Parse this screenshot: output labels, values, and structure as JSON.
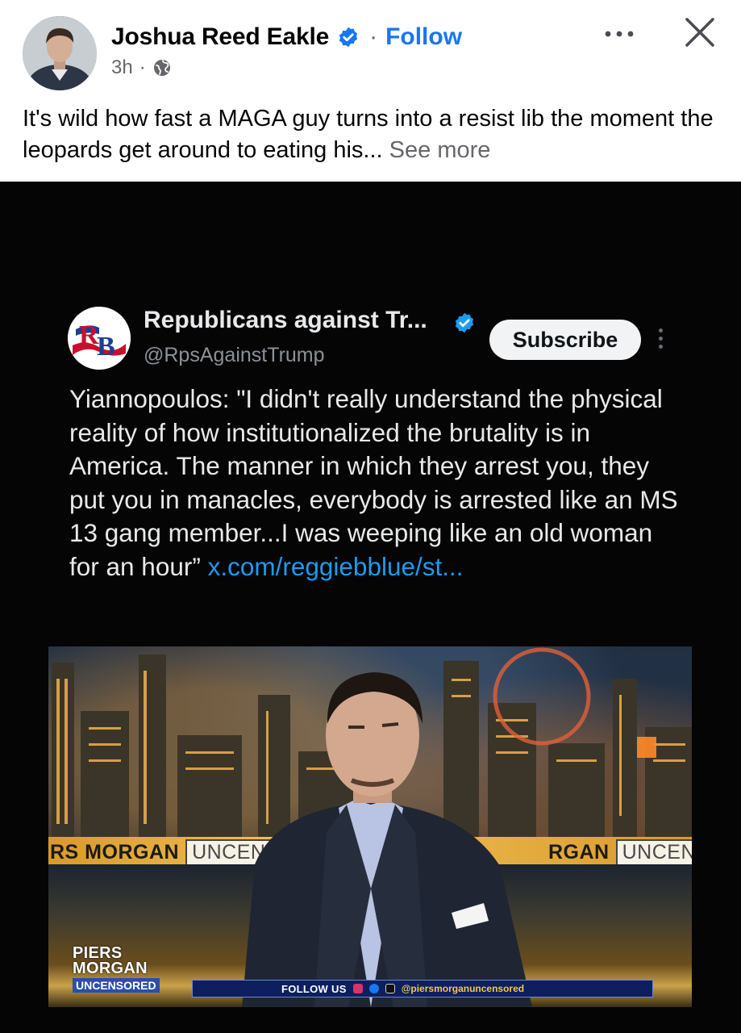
{
  "post": {
    "author": "Joshua Reed Eakle",
    "separator": "·",
    "follow_label": "Follow",
    "time": "3h",
    "meta_separator": "·",
    "text": "It's wild how fast a MAGA guy turns into a resist lib the moment the leopards get around to eating his...",
    "see_more": "See more"
  },
  "icons": {
    "verified": "verified-badge-icon",
    "globe": "globe-icon",
    "more": "more-options-icon",
    "close": "close-icon"
  },
  "tweet": {
    "name": "Republicans against Tr...",
    "handle": "@RpsAgainstTrump",
    "subscribe_label": "Subscribe",
    "avatar_text": "RB",
    "body": "Yiannopoulos: \"I didn't really understand the physical reality of how institutionalized the brutality is in America. The manner in which they arrest you, they put you in manacles, everybody is arrested like an MS 13 gang member...I was weeping like an old woman for an hour” ",
    "link": "x.com/reggiebblue/st..."
  },
  "tv": {
    "banner_left": "RS MORGAN",
    "banner_left_box": "UNCEN",
    "banner_right": "RGAN",
    "banner_right_box": "UNCENS",
    "logo_line1": "PIERS",
    "logo_line2": "MORGAN",
    "logo_sub": "UNCENSORED",
    "follow_us": "FOLLOW US",
    "handle": "@piersmorganuncensored"
  },
  "colors": {
    "facebook_blue": "#1877f2",
    "link_blue": "#1d9bf0",
    "verified_blue": "#1d9bf0",
    "banner_gold": "#f2c35a"
  }
}
